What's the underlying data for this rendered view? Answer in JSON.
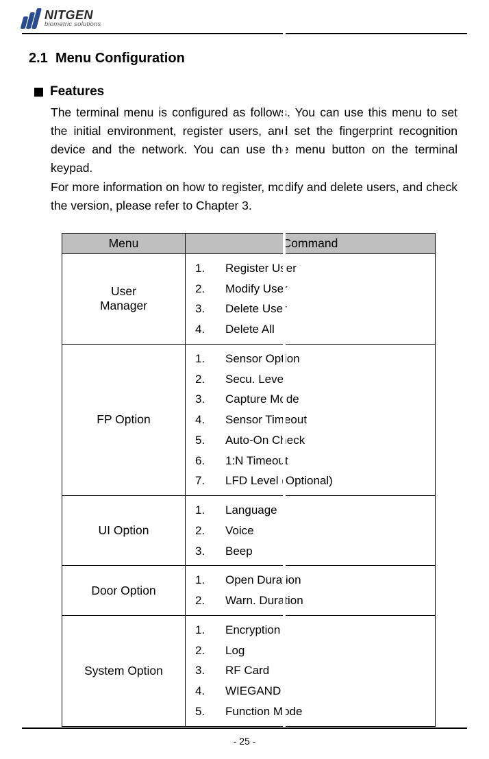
{
  "brand": {
    "name": "NITGEN",
    "tagline": "biometric solutions"
  },
  "section": {
    "number": "2.1",
    "title": "Menu Configuration"
  },
  "features": {
    "heading": "Features",
    "para1": "The terminal menu is configured as follows. You can use this menu to set the initial environment, register users, and set the fingerprint recognition device and the network. You can use the menu button on the terminal keypad.",
    "para2": "For more information on how to register, modify and delete users, and check the version, please refer to Chapter 3."
  },
  "table": {
    "headers": {
      "menu": "Menu",
      "command": "Command"
    },
    "rows": [
      {
        "menu": "User Manager",
        "commands": [
          "Register User",
          "Modify User",
          "Delete User",
          "Delete All"
        ]
      },
      {
        "menu": "FP Option",
        "commands": [
          "Sensor Option",
          "Secu. Level",
          "Capture Mode",
          "Sensor Timeout",
          "Auto-On Check",
          "1:N Timeout",
          "LFD Level (Optional)"
        ]
      },
      {
        "menu": "UI Option",
        "commands": [
          "Language",
          "Voice",
          "Beep"
        ]
      },
      {
        "menu": "Door Option",
        "commands": [
          "Open Duration",
          "Warn. Duration"
        ]
      },
      {
        "menu": "System Option",
        "commands": [
          "Encryption",
          "Log",
          "RF Card",
          "WIEGAND",
          "Function Mode"
        ]
      }
    ]
  },
  "page_number": "- 25 -"
}
